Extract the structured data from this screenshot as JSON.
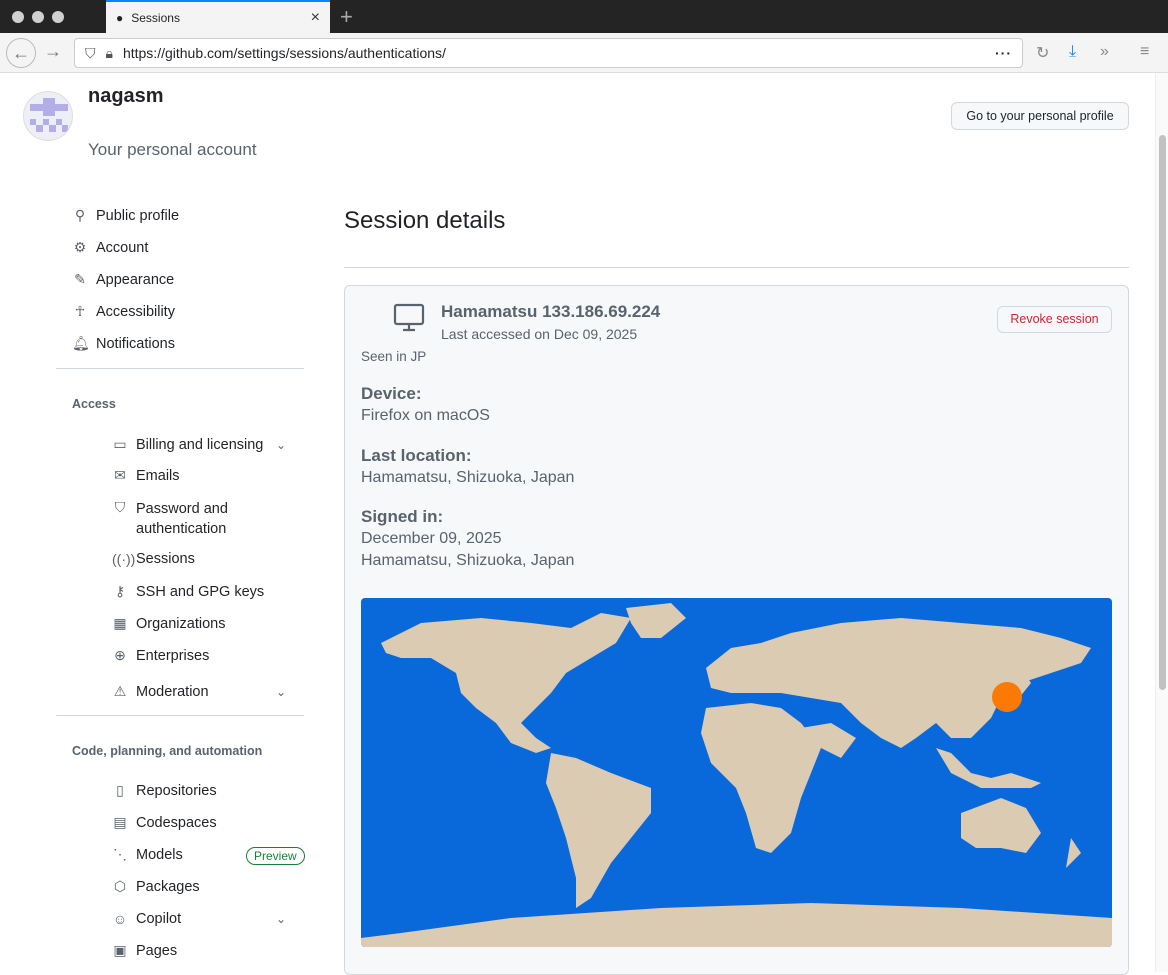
{
  "browser": {
    "tab_title": "Sessions",
    "url": "https://github.com/settings/sessions/authentications/"
  },
  "user": {
    "name": "nagasm",
    "subtitle": "Your personal account",
    "profile_button": "Go to your personal profile"
  },
  "sidebar": {
    "top": [
      {
        "label": "Public profile",
        "icon": "person-icon"
      },
      {
        "label": "Account",
        "icon": "gear-icon"
      },
      {
        "label": "Appearance",
        "icon": "paintbrush-icon"
      },
      {
        "label": "Accessibility",
        "icon": "accessibility-icon"
      },
      {
        "label": "Notifications",
        "icon": "bell-icon"
      }
    ],
    "access_heading": "Access",
    "access": [
      {
        "label": "Billing and licensing",
        "icon": "credit-card-icon"
      },
      {
        "label": "Emails",
        "icon": "mail-icon"
      },
      {
        "label": "Password and",
        "label2": "authentication",
        "icon": "shield-icon"
      },
      {
        "label": "Sessions",
        "icon": "broadcast-icon"
      },
      {
        "label": "SSH and GPG keys",
        "icon": "key-icon"
      },
      {
        "label": "Organizations",
        "icon": "organization-icon"
      },
      {
        "label": "Enterprises",
        "icon": "globe-icon"
      },
      {
        "label": "Moderation",
        "icon": "report-icon"
      }
    ],
    "code_heading": "Code, planning, and automation",
    "code": [
      {
        "label": "Repositories",
        "icon": "repo-icon"
      },
      {
        "label": "Codespaces",
        "icon": "codespaces-icon"
      },
      {
        "label": "Models",
        "icon": "models-icon",
        "badge": "Preview"
      },
      {
        "label": "Packages",
        "icon": "package-icon"
      },
      {
        "label": "Copilot",
        "icon": "copilot-icon"
      },
      {
        "label": "Pages",
        "icon": "browser-icon"
      }
    ]
  },
  "main": {
    "title": "Session details",
    "session": {
      "location_ip": "Hamamatsu 133.186.69.224",
      "last_accessed": "Last accessed on Dec 09, 2025",
      "seen_in": "Seen in JP",
      "revoke": "Revoke session"
    },
    "device_label": "Device:",
    "device": "Firefox on macOS",
    "last_location_label": "Last location:",
    "last_location": "Hamamatsu, Shizuoka, Japan",
    "signed_in_label": "Signed in:",
    "signed_in_date": "December 09, 2025",
    "signed_in_location": "Hamamatsu, Shizuoka, Japan"
  },
  "colors": {
    "map_ocean": "#0969da",
    "land": "#dccbb3",
    "marker": "#fb7a06"
  }
}
